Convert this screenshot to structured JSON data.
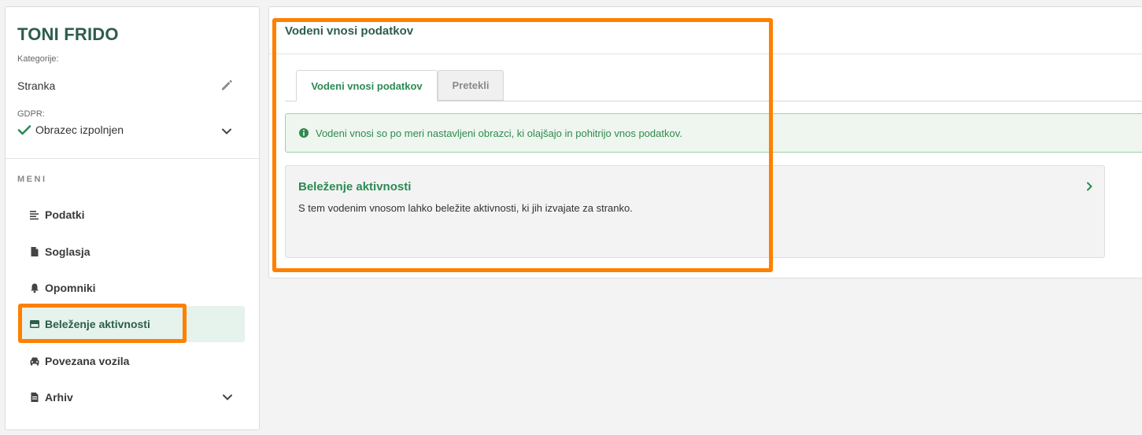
{
  "client": {
    "name": "TONI FRIDO",
    "category_label": "Kategorije:",
    "category_value": "Stranka",
    "gdpr_label": "GDPR:",
    "gdpr_value": "Obrazec izpolnjen"
  },
  "menu": {
    "title": "MENI",
    "items": [
      {
        "label": "Podatki",
        "icon": "list-icon"
      },
      {
        "label": "Soglasja",
        "icon": "document-icon"
      },
      {
        "label": "Opomniki",
        "icon": "bell-icon"
      },
      {
        "label": "Beleženje aktivnosti",
        "icon": "card-icon",
        "active": true
      },
      {
        "label": "Povezana vozila",
        "icon": "car-icon"
      },
      {
        "label": "Arhiv",
        "icon": "document-icon"
      }
    ]
  },
  "main": {
    "title": "Vodeni vnosi podatkov",
    "tabs": [
      {
        "label": "Vodeni vnosi podatkov",
        "active": true
      },
      {
        "label": "Pretekli",
        "active": false
      }
    ],
    "alert": "Vodeni vnosi so po meri nastavljeni obrazci, ki olajšajo in pohitrijo vnos podatkov.",
    "card": {
      "title": "Beleženje aktivnosti",
      "description": "S tem vodenim vnosom lahko beležite aktivnosti, ki jih izvajate za stranko."
    }
  },
  "colors": {
    "brand_dark": "#2d5d4f",
    "brand_green": "#2c8a55",
    "highlight": "#ff8000",
    "active_bg": "#e6f2ec"
  }
}
